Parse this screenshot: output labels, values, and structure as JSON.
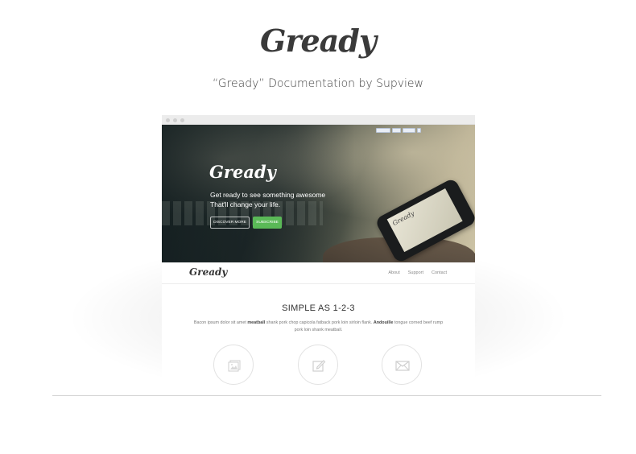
{
  "header": {
    "logo_text": "Gready",
    "subtitle": "“Gready” Documentation by Supview"
  },
  "browser": {
    "chrome_dots": [
      "dot",
      "dot",
      "dot"
    ],
    "hero": {
      "logo_text": "Gready",
      "tagline_line1": "Get ready to see something awesome",
      "tagline_line2": "That'll change your life.",
      "discover_button": "DISCOVER MORE",
      "subscribe_button": "SUBSCRIBE",
      "phone_logo": "Gready"
    },
    "navbar": {
      "logo_text": "Gready",
      "links": [
        "About",
        "Support",
        "Contact"
      ]
    },
    "section": {
      "title": "SIMPLE AS 1-2-3",
      "text_part1": "Bacon ipsum dolor sit amet ",
      "text_bold1": "meatball",
      "text_part2": " shank pork chop capicola fatback pork loin sirloin flank. ",
      "text_bold2": "Andouille",
      "text_part3": " tongue corned beef rump pork loin shank meatball."
    },
    "features": [
      {
        "icon": "image-icon"
      },
      {
        "icon": "edit-icon"
      },
      {
        "icon": "mail-icon"
      }
    ]
  },
  "colors": {
    "accent_green": "#5ab957",
    "text_dark": "#333333",
    "baseline": "#d4d4d4"
  }
}
